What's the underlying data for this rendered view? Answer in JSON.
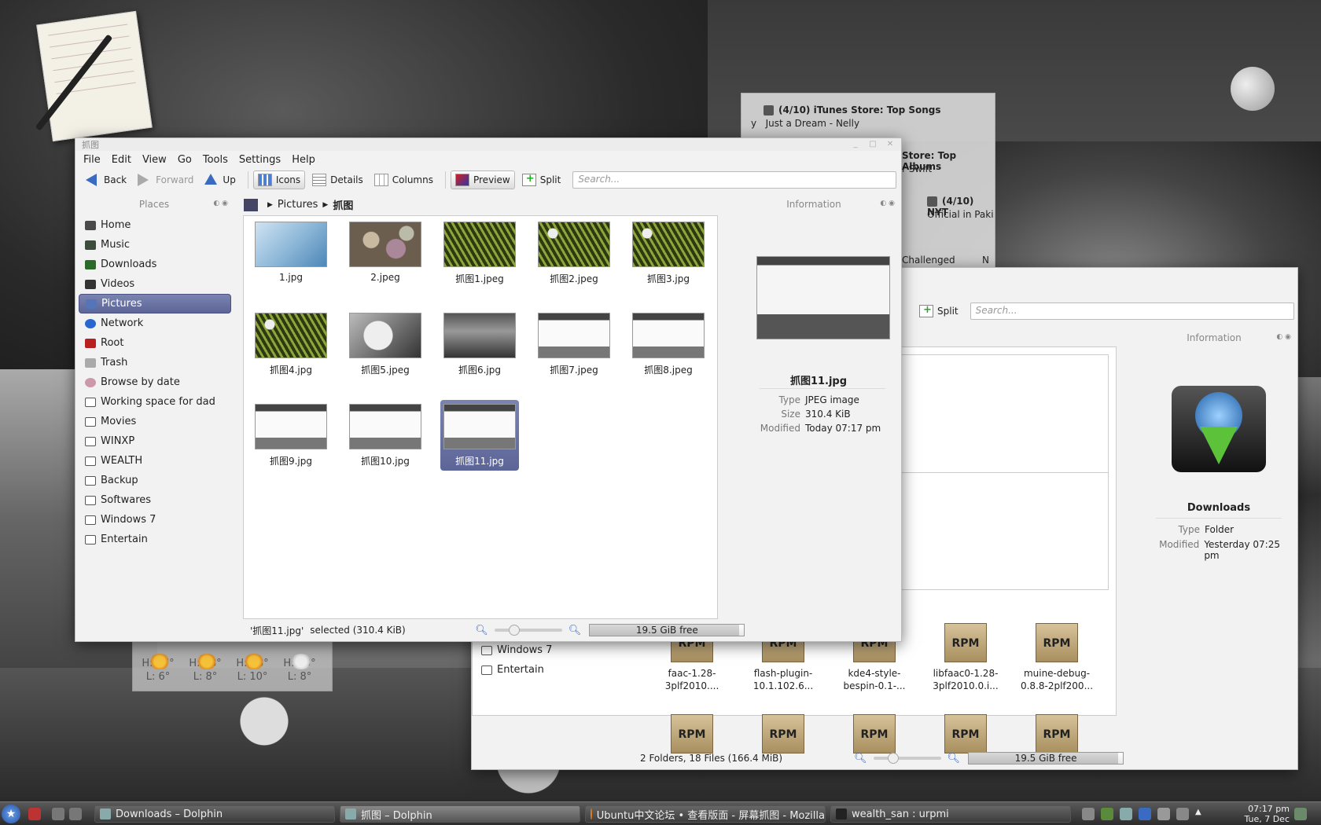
{
  "front_window": {
    "title": "抓图",
    "menu": [
      "File",
      "Edit",
      "View",
      "Go",
      "Tools",
      "Settings",
      "Help"
    ],
    "toolbar": {
      "back": "Back",
      "forward": "Forward",
      "up": "Up",
      "icons": "Icons",
      "details": "Details",
      "columns": "Columns",
      "preview": "Preview",
      "split": "Split",
      "search_placeholder": "Search..."
    },
    "places_title": "Places",
    "places": [
      "Home",
      "Music",
      "Downloads",
      "Videos",
      "Pictures",
      "Network",
      "Root",
      "Trash",
      "Browse by date",
      "Working space for dad",
      "Movies",
      "WINXP",
      "WEALTH",
      "Backup",
      "Softwares",
      "Windows 7",
      "Entertain"
    ],
    "breadcrumb": [
      "Pictures",
      "抓图"
    ],
    "files": [
      "1.jpg",
      "2.jpeg",
      "抓图1.jpeg",
      "抓图2.jpeg",
      "抓图3.jpg",
      "抓图4.jpg",
      "抓图5.jpeg",
      "抓图6.jpg",
      "抓图7.jpeg",
      "抓图8.jpeg",
      "抓图9.jpg",
      "抓图10.jpg",
      "抓图11.jpg"
    ],
    "info_title": "Information",
    "info": {
      "name": "抓图11.jpg",
      "type_label": "Type",
      "type_value": "JPEG image",
      "size_label": "Size",
      "size_value": "310.4 KiB",
      "modified_label": "Modified",
      "modified_value": "Today 07:17 pm"
    },
    "status": {
      "selected_name": "'抓图11.jpg'",
      "selected_text": "selected (310.4 KiB)",
      "free": "19.5 GiB free",
      "used_fraction": 0.97
    }
  },
  "back_window": {
    "split": "Split",
    "search_placeholder": "Search...",
    "info_title": "Information",
    "info": {
      "name": "Downloads",
      "type_label": "Type",
      "type_value": "Folder",
      "modified_label": "Modified",
      "modified_value": "Yesterday 07:25 pm"
    },
    "places": [
      "Windows 7",
      "Entertain"
    ],
    "rpm_label": "RPM",
    "files": [
      [
        "faac-1.28-",
        "3plf2010...."
      ],
      [
        "flash-plugin-",
        "10.1.102.6..."
      ],
      [
        "kde4-style-",
        "bespin-0.1-..."
      ],
      [
        "libfaac0-1.28-",
        "3plf2010.0.i..."
      ],
      [
        "muine-debug-",
        "0.8.8-2plf200..."
      ]
    ],
    "status": {
      "summary": "2 Folders, 18 Files (166.4 MiB)",
      "free": "19.5 GiB free",
      "used_fraction": 0.97
    }
  },
  "news_widget": {
    "items": [
      {
        "head": "(4/10) iTunes Store: Top Songs",
        "prefix": "y",
        "sub": "Just a Dream - Nelly"
      },
      {
        "head": "Store: Top Albums",
        "sub": "r Swift"
      },
      {
        "head": "(4/10) NYT",
        "sub": "Official in Paki"
      },
      {
        "head": "",
        "sub": "Challenged"
      }
    ],
    "extra_n": "N"
  },
  "weather_widget": {
    "days": [
      {
        "high": "H: 17°",
        "low": "L: 6°"
      },
      {
        "high": "H: 18°",
        "low": "L: 8°"
      },
      {
        "high": "H: 18°",
        "low": "L: 10°"
      },
      {
        "high": "H: 13°",
        "low": "L: 8°"
      }
    ]
  },
  "taskbar": {
    "tasks": [
      "Downloads – Dolphin",
      "抓图 – Dolphin",
      "Ubuntu中文论坛 • 查看版面 - 屏幕抓图 - Mozilla",
      "wealth_san : urpmi"
    ],
    "time": "07:17 pm",
    "date": "Tue, 7 Dec"
  },
  "colors": {
    "selection": "#5c6597",
    "accent": "#3a6bc2"
  }
}
